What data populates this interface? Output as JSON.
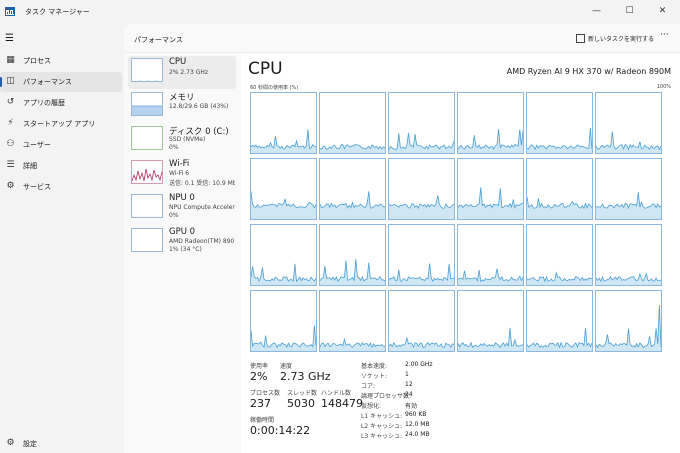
{
  "window": {
    "title": "タスク マネージャー",
    "minimize_glyph": "—",
    "maximize_glyph": "☐",
    "close_glyph": "✕"
  },
  "nav": {
    "menu_glyph": "☰",
    "items": [
      {
        "label": "プロセス",
        "icon": "grid-icon",
        "glyph": "▦"
      },
      {
        "label": "パフォーマンス",
        "icon": "performance-icon",
        "glyph": "◫"
      },
      {
        "label": "アプリの履歴",
        "icon": "history-icon",
        "glyph": "↺"
      },
      {
        "label": "スタートアップ アプリ",
        "icon": "startup-icon",
        "glyph": "⚡"
      },
      {
        "label": "ユーザー",
        "icon": "users-icon",
        "glyph": "⚇"
      },
      {
        "label": "詳細",
        "icon": "details-icon",
        "glyph": "☰"
      },
      {
        "label": "サービス",
        "icon": "services-icon",
        "glyph": "⚙"
      }
    ],
    "settings": {
      "label": "設定",
      "icon": "gear-icon",
      "glyph": "⚙"
    }
  },
  "header": {
    "title": "パフォーマンス",
    "run_task": "新しいタスクを実行する",
    "more": "···"
  },
  "devices": [
    {
      "name": "CPU",
      "sub1": "2%  2.73 GHz",
      "sub2": ""
    },
    {
      "name": "メモリ",
      "sub1": "12.8/29.6 GB (43%)",
      "sub2": ""
    },
    {
      "name": "ディスク 0 (C:)",
      "sub1": "SSD (NVMe)",
      "sub2": "0%"
    },
    {
      "name": "Wi-Fi",
      "sub1": "Wi-Fi 6",
      "sub2": "送信: 0.1  受信: 10.9 Mb"
    },
    {
      "name": "NPU 0",
      "sub1": "NPU Compute Accelera",
      "sub2": "0%"
    },
    {
      "name": "GPU 0",
      "sub1": "AMD Radeon(TM) 890...",
      "sub2": "1%  (34 °C)"
    }
  ],
  "cpu": {
    "title": "CPU",
    "model": "AMD Ryzen AI 9 HX 370 w/ Radeon 890M",
    "graph_caption": "60 秒間の使用率 (%)",
    "graph_max": "100%",
    "core_count": 24,
    "stats": {
      "usage_label": "使用率",
      "usage": "2%",
      "speed_label": "速度",
      "speed": "2.73 GHz",
      "processes_label": "プロセス数",
      "processes": "237",
      "threads_label": "スレッド数",
      "threads": "5030",
      "handles_label": "ハンドル数",
      "handles": "148479",
      "uptime_label": "稼働時間",
      "uptime": "0:00:14:22"
    },
    "specs": [
      {
        "label": "基本速度:",
        "value": "2.00 GHz"
      },
      {
        "label": "ソケット:",
        "value": "1"
      },
      {
        "label": "コア:",
        "value": "12"
      },
      {
        "label": "論理プロセッサ数:",
        "value": "24"
      },
      {
        "label": "仮想化:",
        "value": "有効"
      },
      {
        "label": "L1 キャッシュ:",
        "value": "960 KB"
      },
      {
        "label": "L2 キャッシュ:",
        "value": "12.0 MB"
      },
      {
        "label": "L3 キャッシュ:",
        "value": "24.0 MB"
      }
    ]
  },
  "colors": {
    "cpu_line": "#4a9fd4",
    "cpu_fill": "#cfe6f5",
    "memory_fill": "#b5d3f0",
    "wifi_line": "#b0315f",
    "accent": "#1e5fae"
  }
}
